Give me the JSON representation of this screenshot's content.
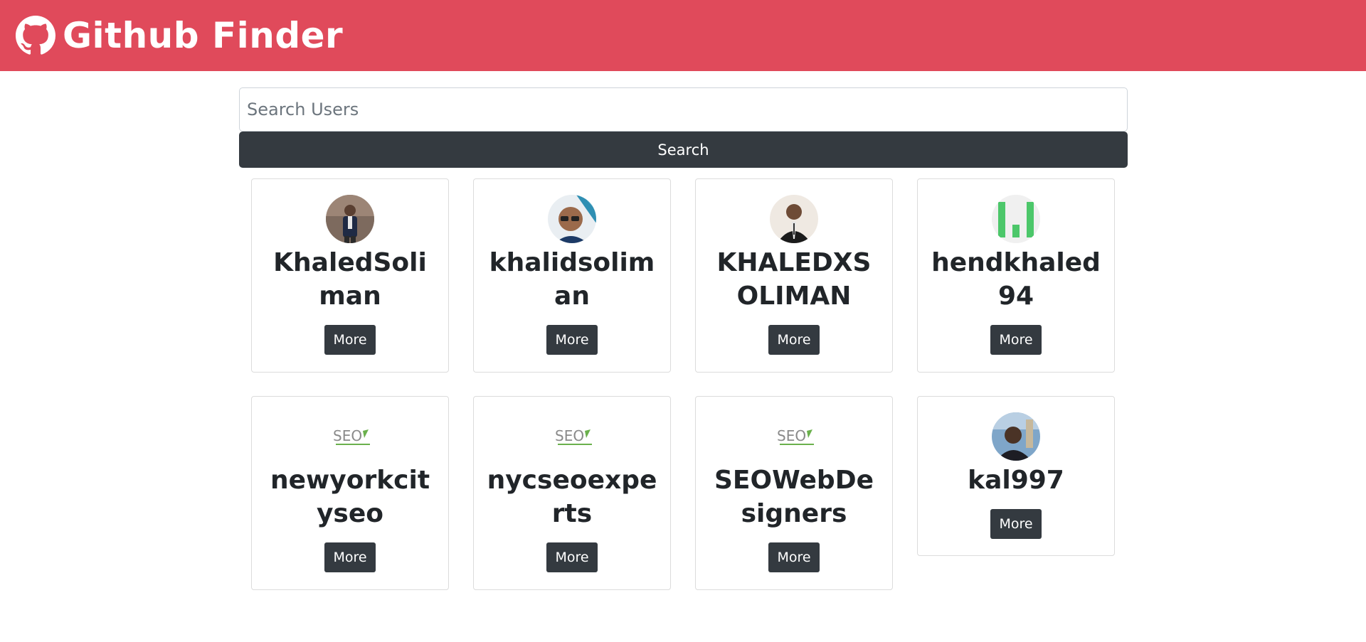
{
  "header": {
    "title": "Github Finder",
    "icon": "github-icon",
    "background_color": "#e04a5b"
  },
  "search": {
    "placeholder": "Search Users",
    "value": "",
    "button_label": "Search",
    "button_color": "#343a40"
  },
  "users": [
    {
      "login": "KhaledSoliman",
      "avatar": "photo-avatar",
      "more_label": "More"
    },
    {
      "login": "khalidsoliman",
      "avatar": "photo-avatar",
      "more_label": "More"
    },
    {
      "login": "KHALEDXSOLIMAN",
      "avatar": "photo-avatar",
      "more_label": "More"
    },
    {
      "login": "hendkhaled94",
      "avatar": "identicon-avatar",
      "more_label": "More"
    },
    {
      "login": "newyorkcityseo",
      "avatar": "seo-logo-avatar",
      "more_label": "More"
    },
    {
      "login": "nycseoexperts",
      "avatar": "seo-logo-avatar",
      "more_label": "More"
    },
    {
      "login": "SEOWebDesigners",
      "avatar": "seo-logo-avatar",
      "more_label": "More"
    },
    {
      "login": "kal997",
      "avatar": "photo-avatar",
      "more_label": "More"
    }
  ]
}
